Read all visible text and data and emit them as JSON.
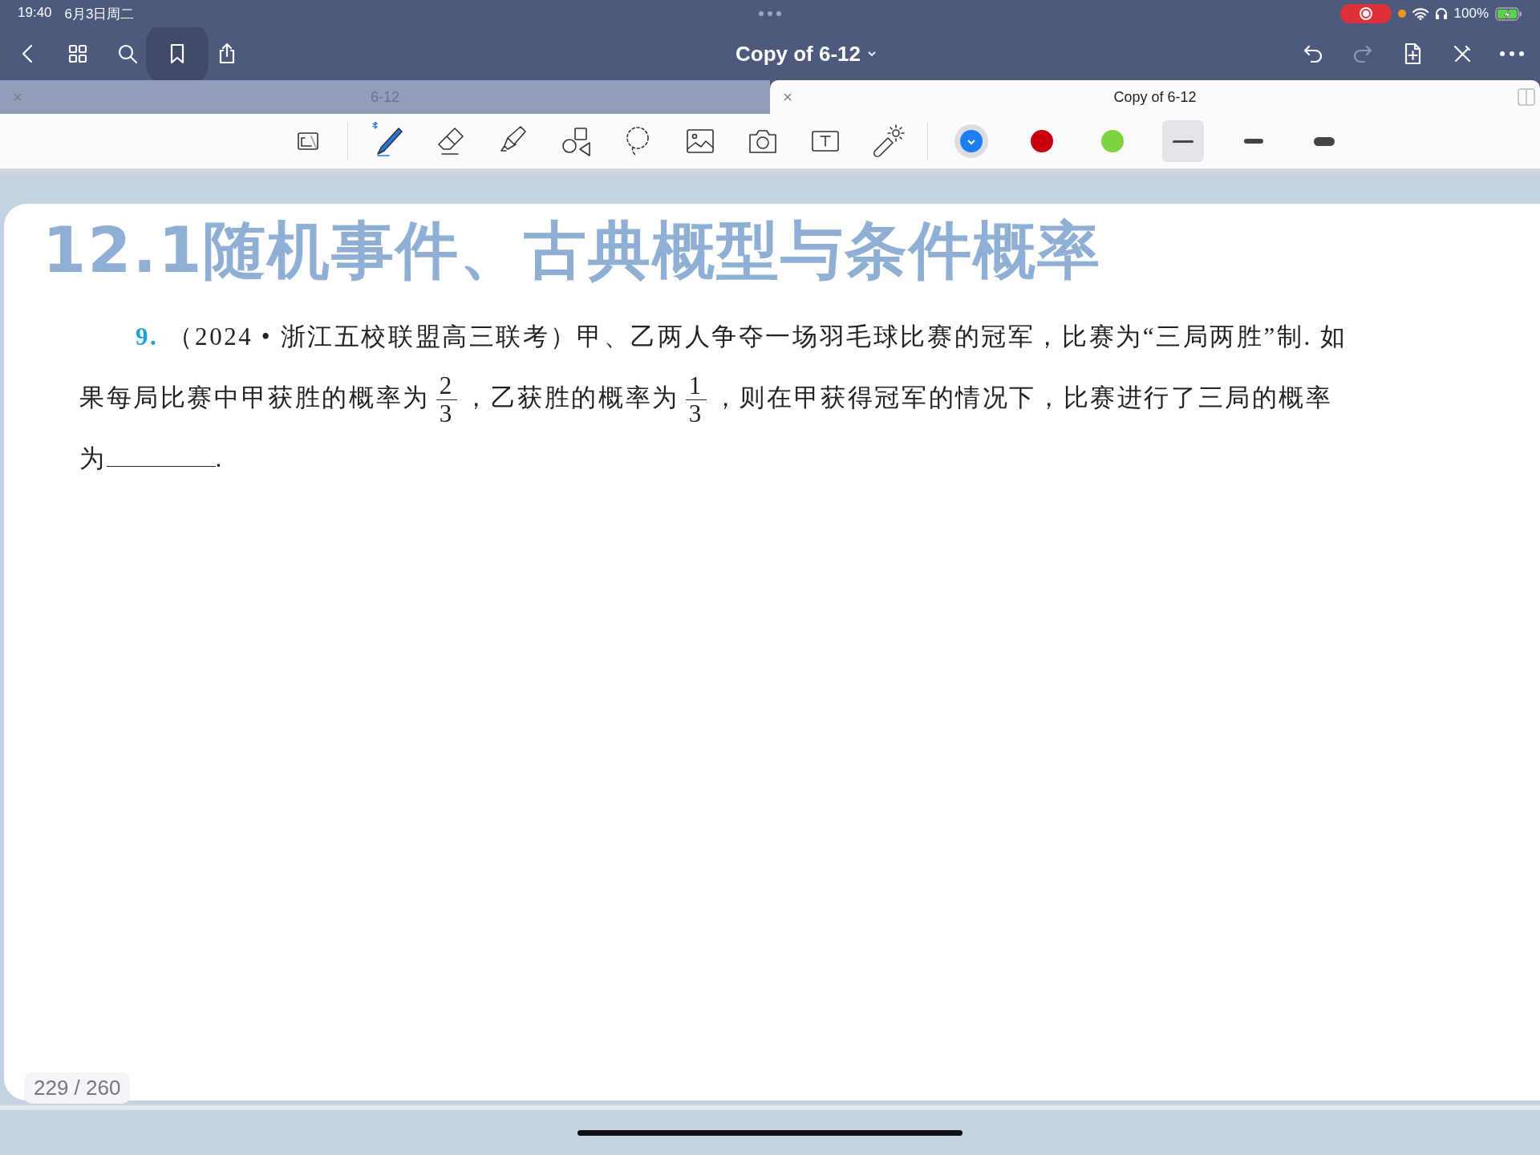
{
  "status_bar": {
    "time": "19:40",
    "date": "6月3日周二",
    "battery": "100%",
    "recording": true,
    "charging": true
  },
  "nav_bar": {
    "title": "Copy of 6-12",
    "left_buttons": [
      {
        "kind": "back",
        "highlighted": false
      },
      {
        "kind": "grid",
        "highlighted": false
      },
      {
        "kind": "search",
        "highlighted": false
      },
      {
        "kind": "bookmark",
        "highlighted": true
      },
      {
        "kind": "share",
        "highlighted": false
      }
    ],
    "right_buttons": [
      {
        "kind": "undo",
        "disabled": false
      },
      {
        "kind": "redo",
        "disabled": true
      },
      {
        "kind": "add-page",
        "disabled": false
      },
      {
        "kind": "pen-off",
        "disabled": false
      },
      {
        "kind": "more",
        "disabled": false
      }
    ]
  },
  "tabs": [
    {
      "label": "6-12",
      "selected": false
    },
    {
      "label": "Copy of 6-12",
      "selected": true
    }
  ],
  "toolbar": {
    "tools": [
      {
        "kind": "zoom-window",
        "selected": false
      },
      {
        "kind": "pen",
        "selected": true
      },
      {
        "kind": "eraser",
        "selected": false
      },
      {
        "kind": "highlighter",
        "selected": false
      },
      {
        "kind": "shapes",
        "selected": false
      },
      {
        "kind": "lasso",
        "selected": false
      },
      {
        "kind": "image",
        "selected": false
      },
      {
        "kind": "camera",
        "selected": false
      },
      {
        "kind": "text",
        "selected": false
      },
      {
        "kind": "laser",
        "selected": false
      }
    ],
    "colors": [
      {
        "color": "#1a7ef0",
        "selected": true
      },
      {
        "color": "#c8000c",
        "selected": false
      },
      {
        "color": "#7ed33e",
        "selected": false
      }
    ],
    "strokes": [
      {
        "kind": "thin",
        "selected": true
      },
      {
        "kind": "medium",
        "selected": false
      },
      {
        "kind": "thick",
        "selected": false
      }
    ]
  },
  "page": {
    "heading": "12.1随机事件、古典概型与条件概率",
    "question": {
      "number": "9.",
      "parts": [
        {
          "kind": "text",
          "text": "（2024 • 浙江五校联盟高三联考）甲、乙两人争夺一场羽毛球比赛的冠军，比赛为“三局两胜”制. 如果每局比赛中甲获胜的概率为"
        },
        {
          "kind": "fraction",
          "numerator": "2",
          "denominator": "3"
        },
        {
          "kind": "text",
          "text": "，乙获胜的概率为"
        },
        {
          "kind": "fraction",
          "numerator": "1",
          "denominator": "3"
        },
        {
          "kind": "text",
          "text": "，则在甲获得冠军的情况下，比赛进行了三局的概率为"
        },
        {
          "kind": "blank"
        },
        {
          "kind": "text",
          "text": "."
        }
      ]
    },
    "page_counter": "229 / 260"
  }
}
